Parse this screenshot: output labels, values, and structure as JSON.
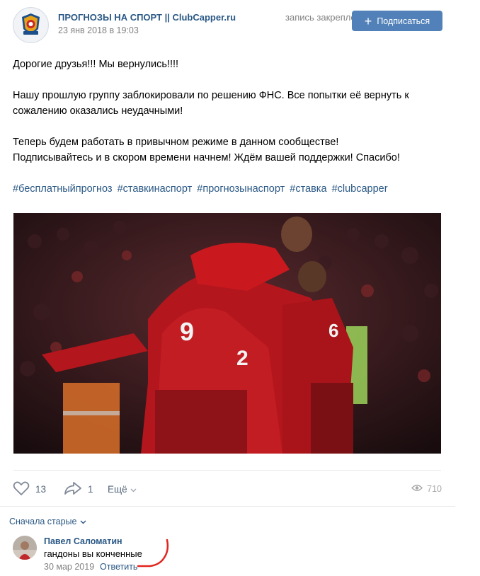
{
  "post": {
    "group_name": "ПРОГНОЗЫ НА СПОРТ || ClubCapper.ru",
    "pinned_label": "запись закреплена",
    "date": "23 янв 2018 в 19:03",
    "subscribe_label": "Подписаться",
    "paragraphs": [
      "Дорогие друзья!!! Мы вернулись!!!!",
      "Нашу прошлую группу заблокировали по решению ФНС. Все попытки её вернуть к сожалению оказались неудачными!",
      "Теперь будем работать в привычном режиме в данном сообществе!\nПодписывайтесь и в скором времени начнем! Ждём вашей поддержки! Спасибо!"
    ],
    "hashtags": [
      "#бесплатныйпрогноз",
      "#ставкинаспорт",
      "#прогнозынаспорт",
      "#ставка",
      "#clubcapper"
    ]
  },
  "actions": {
    "likes": "13",
    "shares": "1",
    "more_label": "Ещё",
    "views": "710"
  },
  "comments": {
    "sort_label": "Сначала старые",
    "items": [
      {
        "author": "Павел Саломатин",
        "text": "гандоны вы конченные",
        "date": "30 мар 2019",
        "reply_label": "Ответить"
      }
    ]
  },
  "colors": {
    "link": "#2a5885",
    "button": "#5181b8",
    "muted": "#828282",
    "annotation": "#e0261f"
  },
  "icons": [
    "heart-icon",
    "share-icon",
    "chevron-down-icon",
    "eye-icon"
  ]
}
